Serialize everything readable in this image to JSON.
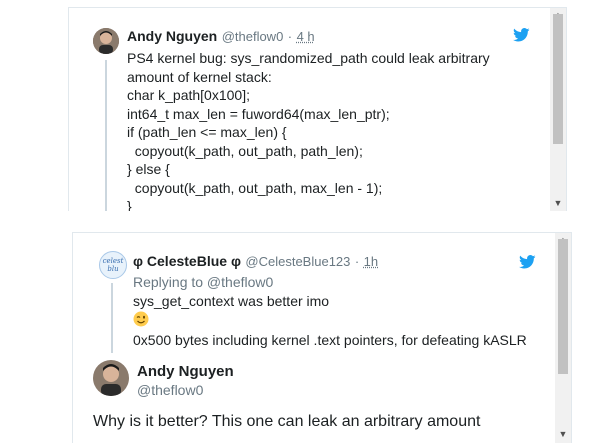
{
  "tweet1": {
    "author_name": "Andy Nguyen",
    "author_handle": "@theflow0",
    "separator": "·",
    "time": "4 h",
    "lines": [
      "PS4 kernel bug: sys_randomized_path could leak arbitrary",
      "amount of kernel stack:",
      "char k_path[0x100];",
      "int64_t max_len = fuword64(max_len_ptr);",
      "if (path_len <= max_len) {",
      "  copyout(k_path, out_path, path_len);",
      "} else {",
      "  copyout(k_path, out_path, max_len - 1);",
      "}"
    ]
  },
  "tweet2": {
    "author_name": "φ CelesteBlue φ",
    "author_handle": "@CelesteBlue123",
    "separator": "·",
    "time": "1h",
    "replying_to": "Replying to @theflow0",
    "text_line1": "sys_get_context was better imo",
    "emoji": "😉",
    "text_line2": "0x500 bytes including kernel .text pointers, for defeating kASLR",
    "avatar_text": "celest blu"
  },
  "tweet3": {
    "author_name": "Andy Nguyen",
    "author_handle": "@theflow0",
    "text": "Why is it better? This one can leak an arbitrary amount"
  },
  "icons": {
    "twitter_bird": "twitter-bird-icon",
    "scroll_up": "▲",
    "scroll_down": "▼"
  },
  "colors": {
    "twitter_blue": "#1da1f2",
    "handle_gray": "#697882"
  }
}
